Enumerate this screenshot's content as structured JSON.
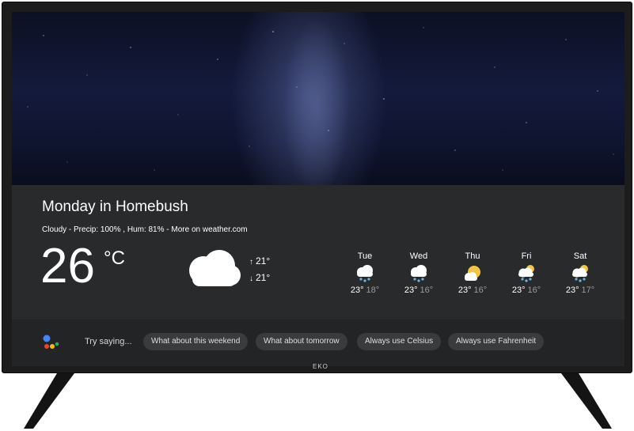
{
  "weather": {
    "title": "Monday in Homebush",
    "details": "Cloudy - Precip: 100%  , Hum: 81% - More on weather.com",
    "current_temp": "26",
    "unit": "°C",
    "high": "21°",
    "low": "21°",
    "condition_icon": "cloud-icon"
  },
  "forecast": [
    {
      "day": "Tue",
      "high": "23°",
      "low": "18°",
      "icon": "snow-cloud-icon"
    },
    {
      "day": "Wed",
      "high": "23°",
      "low": "16°",
      "icon": "snow-cloud-icon"
    },
    {
      "day": "Thu",
      "high": "23°",
      "low": "16°",
      "icon": "partly-sunny-icon"
    },
    {
      "day": "Fri",
      "high": "23°",
      "low": "16°",
      "icon": "sun-snow-cloud-icon"
    },
    {
      "day": "Sat",
      "high": "23°",
      "low": "17°",
      "icon": "sun-snow-cloud-icon"
    }
  ],
  "assistant": {
    "prompt": "Try saying...",
    "suggestions": [
      "What about this weekend",
      "What about tomorrow",
      "Always use Celsius",
      "Always use Fahrenheit"
    ]
  },
  "tv": {
    "brand": "EKO"
  },
  "colors": {
    "google_blue": "#4285F4",
    "google_red": "#EA4335",
    "google_yellow": "#FBBC05",
    "google_green": "#34A853",
    "sun": "#F5C542"
  }
}
